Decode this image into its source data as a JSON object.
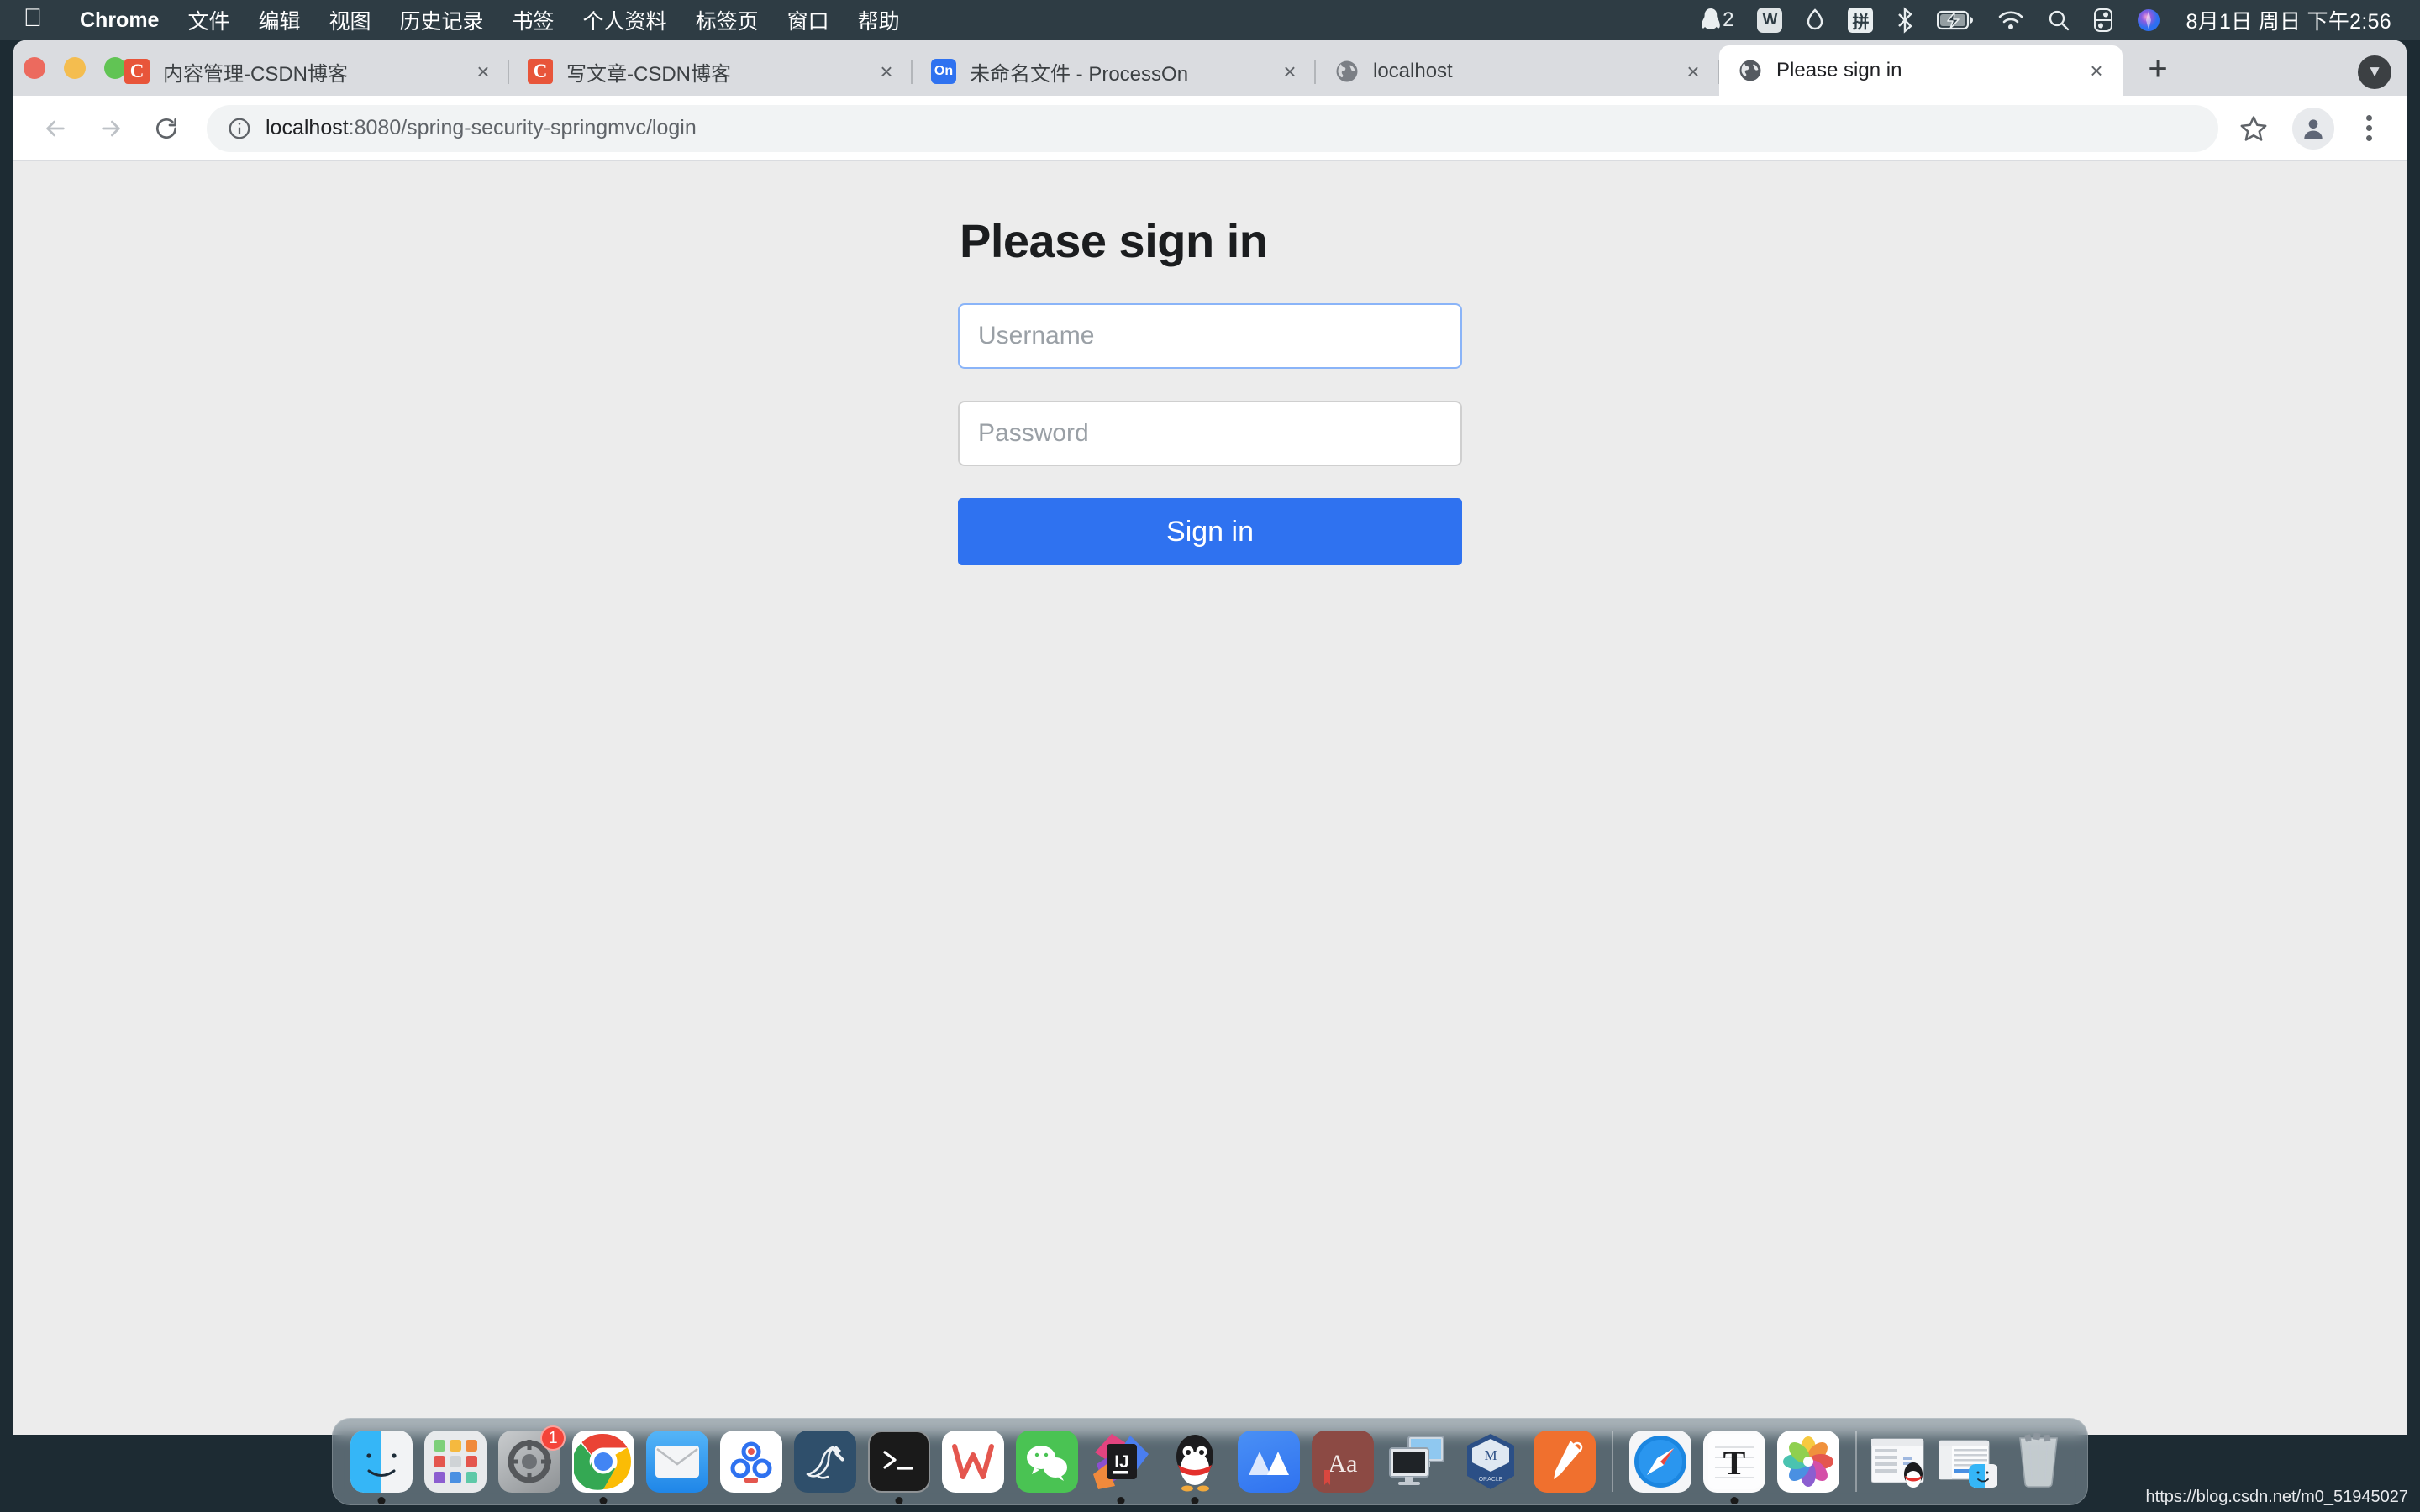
{
  "menubar": {
    "apple_icon": "apple-logo",
    "items": [
      {
        "label": "Chrome",
        "bold": true
      },
      {
        "label": "文件",
        "bold": false
      },
      {
        "label": "编辑",
        "bold": false
      },
      {
        "label": "视图",
        "bold": false
      },
      {
        "label": "历史记录",
        "bold": false
      },
      {
        "label": "书签",
        "bold": false
      },
      {
        "label": "个人资料",
        "bold": false
      },
      {
        "label": "标签页",
        "bold": false
      },
      {
        "label": "窗口",
        "bold": false
      },
      {
        "label": "帮助",
        "bold": false
      }
    ],
    "status_icons": [
      {
        "name": "qq-icon",
        "badge": "2"
      },
      {
        "name": "wps-icon",
        "glyph": "W"
      },
      {
        "name": "dropbox-icon"
      },
      {
        "name": "pinyin-input-icon",
        "glyph": "拼"
      },
      {
        "name": "bluetooth-icon"
      },
      {
        "name": "battery-charging-icon"
      },
      {
        "name": "wifi-icon"
      },
      {
        "name": "spotlight-search-icon"
      },
      {
        "name": "control-center-icon"
      },
      {
        "name": "siri-icon"
      }
    ],
    "clock": "8月1日 周日 下午2:56"
  },
  "browser": {
    "tabs": [
      {
        "title": "内容管理-CSDN博客",
        "favicon": "csdn-icon",
        "favicon_glyph": "C",
        "active": false
      },
      {
        "title": "写文章-CSDN博客",
        "favicon": "csdn-icon",
        "favicon_glyph": "C",
        "active": false
      },
      {
        "title": "未命名文件 - ProcessOn",
        "favicon": "processon-icon",
        "favicon_glyph": "On",
        "active": false
      },
      {
        "title": "localhost",
        "favicon": "globe-icon",
        "favicon_glyph": "",
        "active": false
      },
      {
        "title": "Please sign in",
        "favicon": "globe-icon",
        "favicon_glyph": "",
        "active": true
      }
    ],
    "tab_close_label": "×",
    "new_tab_label": "+",
    "tab_search_label": "▼",
    "toolbar": {
      "back_label": "←",
      "forward_label": "→",
      "reload_label": "↻",
      "site_info_label": "ⓘ",
      "url_host": "localhost",
      "url_rest": ":8080/spring-security-springmvc/login",
      "bookmark_label": "☆",
      "menu_label": "more-options"
    }
  },
  "page": {
    "title": "Please sign in",
    "username_placeholder": "Username",
    "username_value": "",
    "password_placeholder": "Password",
    "password_value": "",
    "signin_button": "Sign in",
    "status_link": "https://blog.csdn.net/m0_51945027",
    "accent_color": "#2f72f0",
    "focus_border_color": "#8ab4f8",
    "background_color": "#ececec"
  },
  "dock": {
    "items": [
      {
        "name": "finder-icon",
        "running": true
      },
      {
        "name": "launchpad-icon",
        "running": false
      },
      {
        "name": "system-preferences-icon",
        "running": false,
        "badge": "1"
      },
      {
        "name": "chrome-icon",
        "running": true
      },
      {
        "name": "mail-icon",
        "running": false
      },
      {
        "name": "baidu-netdisk-icon",
        "running": false
      },
      {
        "name": "mysql-workbench-icon",
        "running": false
      },
      {
        "name": "terminal-icon",
        "running": true
      },
      {
        "name": "wps-office-icon",
        "running": false
      },
      {
        "name": "wechat-icon",
        "running": false
      },
      {
        "name": "intellij-idea-icon",
        "running": true
      },
      {
        "name": "qq-icon",
        "running": true
      },
      {
        "name": "mindmaster-icon",
        "running": false
      },
      {
        "name": "dictionary-icon",
        "running": false
      },
      {
        "name": "screen-sharing-icon",
        "running": false
      },
      {
        "name": "virtualbox-icon",
        "running": false
      },
      {
        "name": "screwdriver-tool-icon",
        "running": false
      }
    ],
    "items_right": [
      {
        "name": "safari-icon",
        "running": false
      },
      {
        "name": "textedit-icon",
        "running": true
      },
      {
        "name": "photos-icon",
        "running": false
      }
    ],
    "minimized": [
      {
        "name": "minimized-qq-window"
      },
      {
        "name": "minimized-finder-window"
      }
    ],
    "trash": {
      "name": "trash-icon"
    }
  }
}
